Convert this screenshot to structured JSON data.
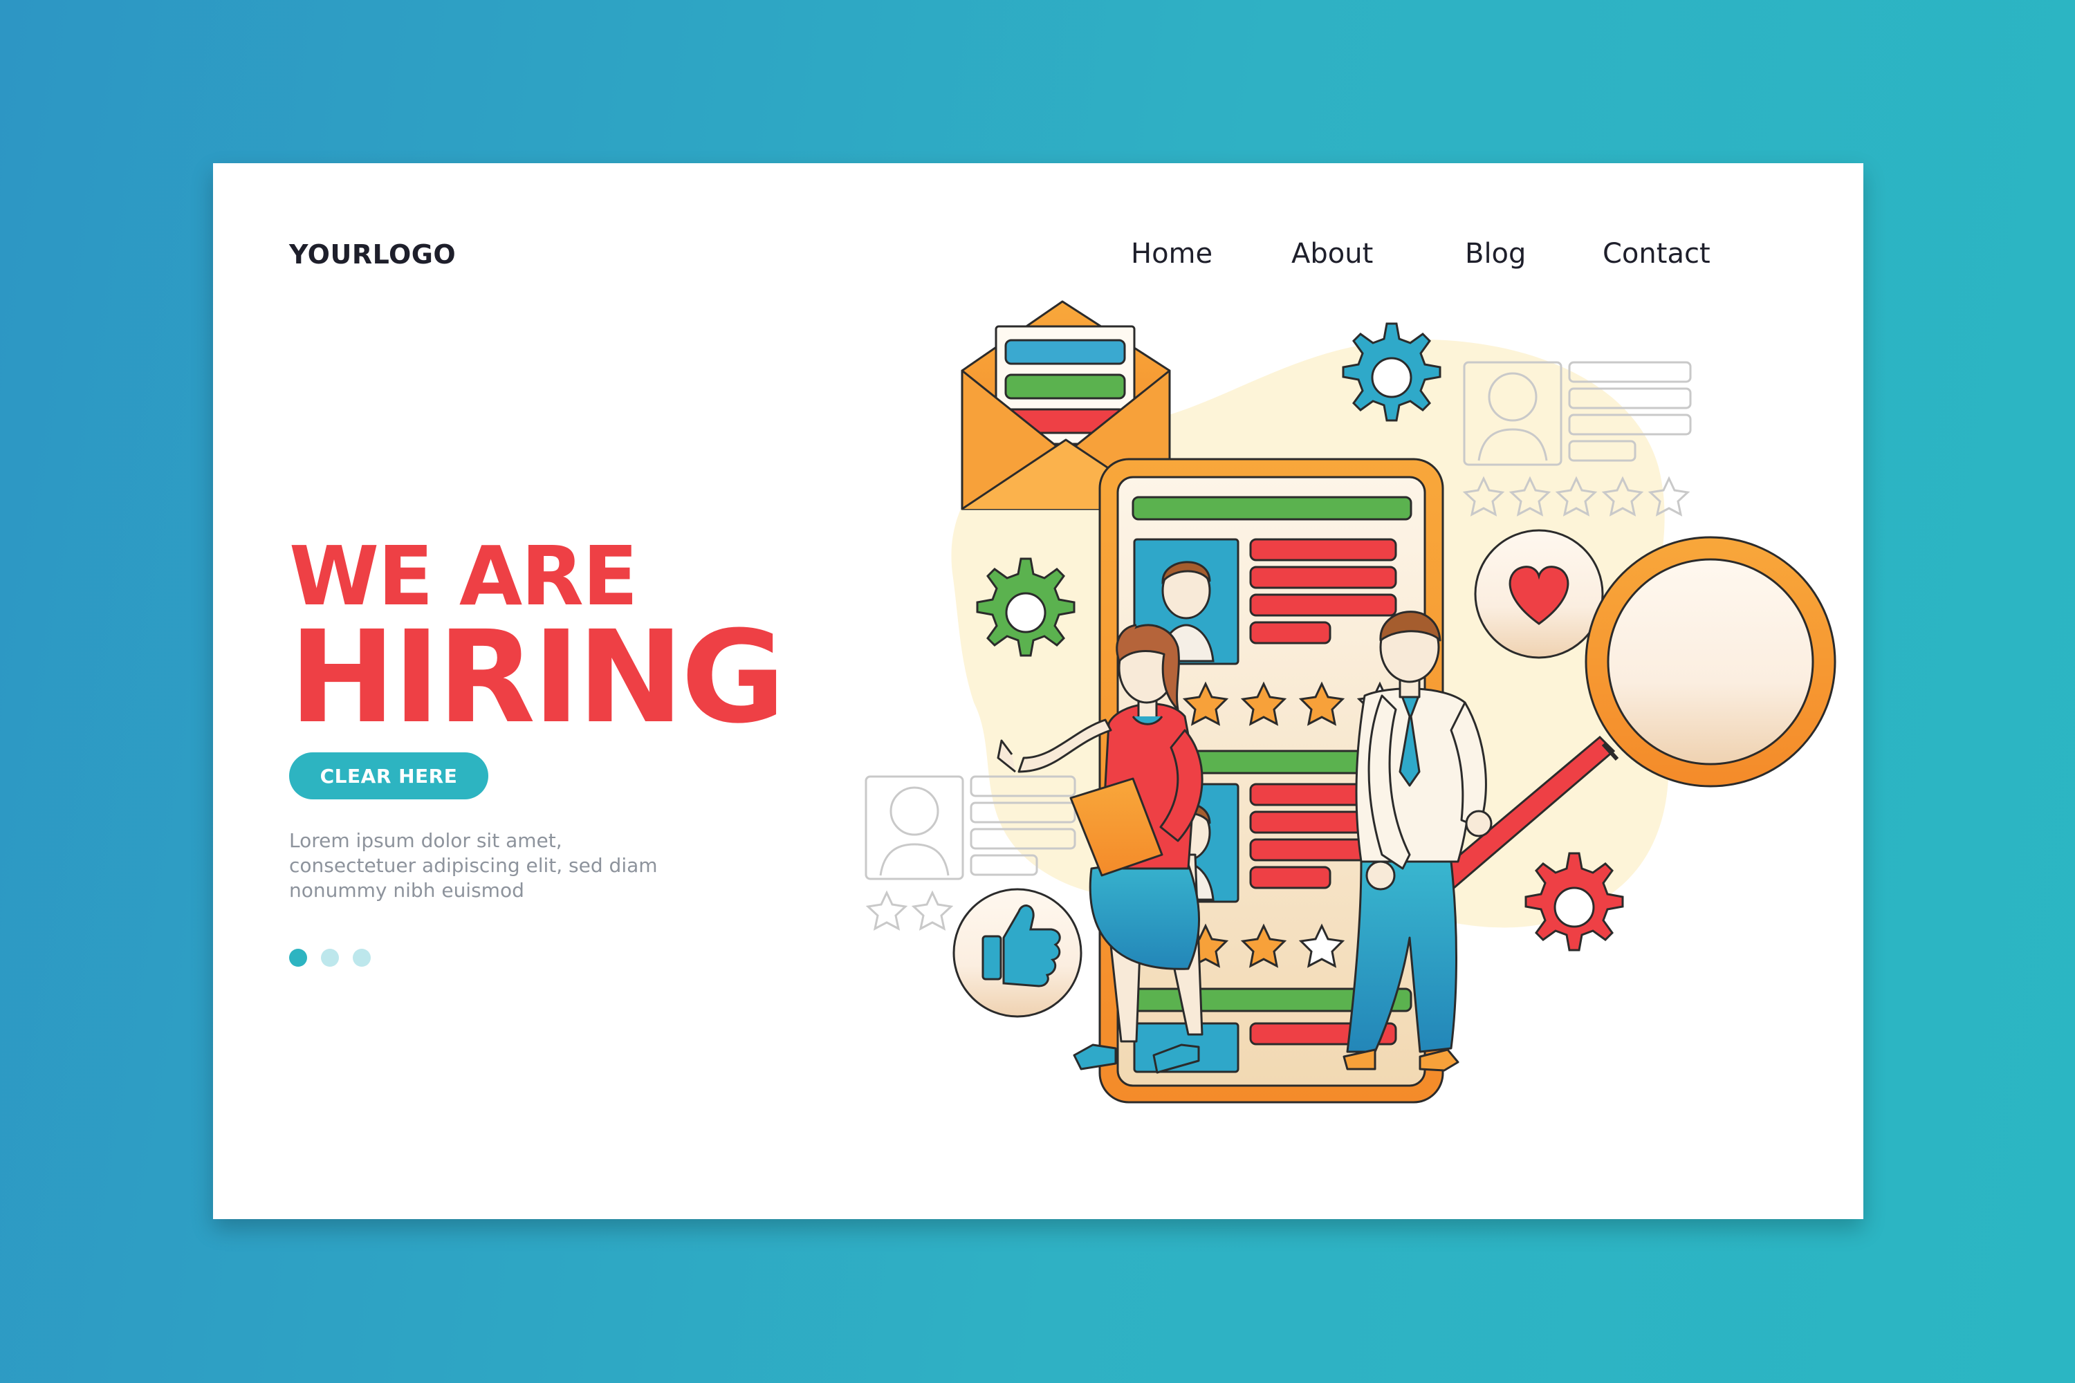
{
  "header": {
    "logo": "YOURLOGO",
    "nav": [
      {
        "label": "Home"
      },
      {
        "label": "About"
      },
      {
        "label": "Blog"
      },
      {
        "label": "Contact"
      }
    ]
  },
  "hero": {
    "headline_line1": "WE ARE",
    "headline_line2": "HIRING",
    "cta_label": "CLEAR HERE",
    "body": "Lorem ipsum dolor sit amet, consectetuer adipiscing elit, sed diam nonummy nibh euismod"
  },
  "carousel": {
    "slides": 3,
    "active_index": 0
  },
  "colors": {
    "background": "#2fa9c4",
    "accent": "#2db4c1",
    "headline": "#ee4045",
    "text_dark": "#1e1f2b",
    "text_muted": "#8d939c"
  },
  "illustration": {
    "icons": [
      "envelope-icon",
      "gear-icon",
      "heart-icon",
      "thumbs-up-icon",
      "magnifier-icon",
      "star-icon",
      "profile-card-icon"
    ]
  }
}
